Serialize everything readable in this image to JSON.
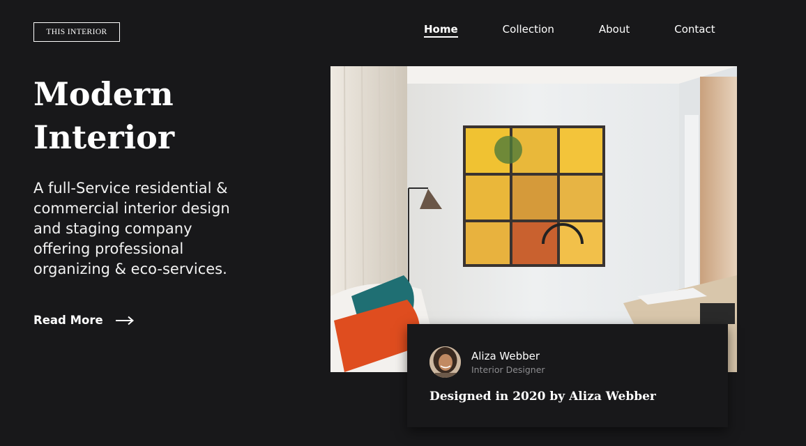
{
  "header": {
    "logo_text": "THIS INTERIOR",
    "nav": [
      {
        "label": "Home",
        "active": true
      },
      {
        "label": "Collection",
        "active": false
      },
      {
        "label": "About",
        "active": false
      },
      {
        "label": "Contact",
        "active": false
      }
    ]
  },
  "hero": {
    "title": "Modern Interior",
    "description": "A full-Service residential & commercial interior design and staging company offering professional organizing & eco-services.",
    "cta_label": "Read More",
    "cta_icon": "arrow-right-icon"
  },
  "feature": {
    "image_icon": "interior-photo",
    "designer_name": "Aliza Webber",
    "designer_role": "Interior Designer",
    "caption": "Designed in 2020 by Aliza Webber"
  },
  "colors": {
    "background": "#18181a",
    "text": "#ffffff",
    "muted": "#8d8d90"
  }
}
